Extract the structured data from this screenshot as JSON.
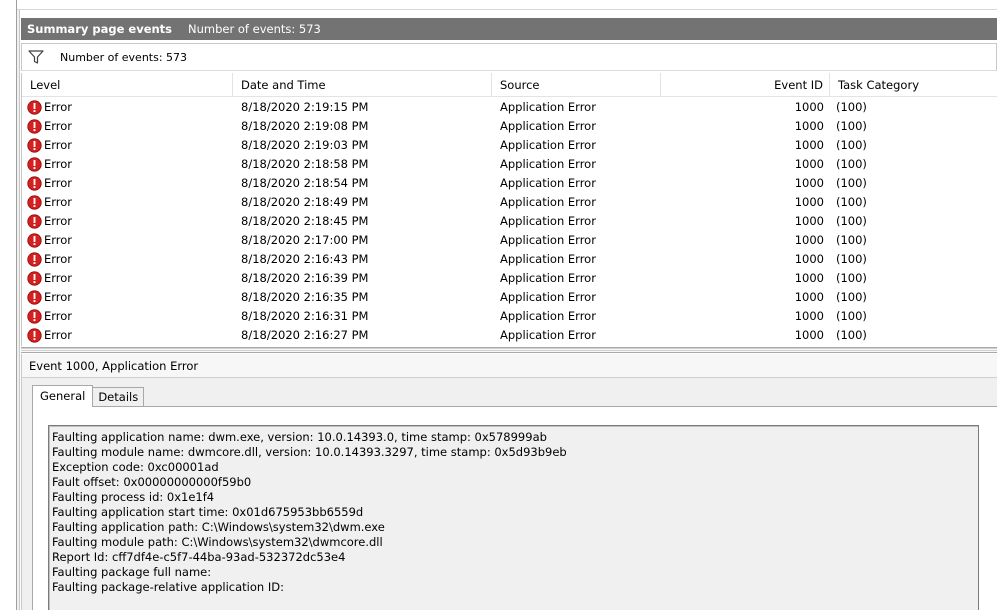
{
  "title_bar": {
    "title": "Summary page events",
    "count_text": "Number of events: 573"
  },
  "filter": {
    "count_text": "Number of events: 573"
  },
  "table": {
    "columns": [
      "Level",
      "Date and Time",
      "Source",
      "Event ID",
      "Task Category"
    ],
    "rows": [
      {
        "level": "Error",
        "date": "8/18/2020 2:19:15 PM",
        "source": "Application Error",
        "event_id": "1000",
        "task": "(100)"
      },
      {
        "level": "Error",
        "date": "8/18/2020 2:19:08 PM",
        "source": "Application Error",
        "event_id": "1000",
        "task": "(100)"
      },
      {
        "level": "Error",
        "date": "8/18/2020 2:19:03 PM",
        "source": "Application Error",
        "event_id": "1000",
        "task": "(100)"
      },
      {
        "level": "Error",
        "date": "8/18/2020 2:18:58 PM",
        "source": "Application Error",
        "event_id": "1000",
        "task": "(100)"
      },
      {
        "level": "Error",
        "date": "8/18/2020 2:18:54 PM",
        "source": "Application Error",
        "event_id": "1000",
        "task": "(100)"
      },
      {
        "level": "Error",
        "date": "8/18/2020 2:18:49 PM",
        "source": "Application Error",
        "event_id": "1000",
        "task": "(100)"
      },
      {
        "level": "Error",
        "date": "8/18/2020 2:18:45 PM",
        "source": "Application Error",
        "event_id": "1000",
        "task": "(100)"
      },
      {
        "level": "Error",
        "date": "8/18/2020 2:17:00 PM",
        "source": "Application Error",
        "event_id": "1000",
        "task": "(100)"
      },
      {
        "level": "Error",
        "date": "8/18/2020 2:16:43 PM",
        "source": "Application Error",
        "event_id": "1000",
        "task": "(100)"
      },
      {
        "level": "Error",
        "date": "8/18/2020 2:16:39 PM",
        "source": "Application Error",
        "event_id": "1000",
        "task": "(100)"
      },
      {
        "level": "Error",
        "date": "8/18/2020 2:16:35 PM",
        "source": "Application Error",
        "event_id": "1000",
        "task": "(100)"
      },
      {
        "level": "Error",
        "date": "8/18/2020 2:16:31 PM",
        "source": "Application Error",
        "event_id": "1000",
        "task": "(100)"
      },
      {
        "level": "Error",
        "date": "8/18/2020 2:16:27 PM",
        "source": "Application Error",
        "event_id": "1000",
        "task": "(100)"
      }
    ]
  },
  "detail": {
    "header": "Event 1000, Application Error",
    "tabs": [
      "General",
      "Details"
    ],
    "message_lines": [
      "Faulting application name: dwm.exe, version: 10.0.14393.0, time stamp: 0x578999ab",
      "Faulting module name: dwmcore.dll, version: 10.0.14393.3297, time stamp: 0x5d93b9eb",
      "Exception code: 0xc00001ad",
      "Fault offset: 0x00000000000f59b0",
      "Faulting process id: 0x1e1f4",
      "Faulting application start time: 0x01d675953bb6559d",
      "Faulting application path: C:\\Windows\\system32\\dwm.exe",
      "Faulting module path: C:\\Windows\\system32\\dwmcore.dll",
      "Report Id: cff7df4e-c5f7-44ba-93ad-532372dc53e4",
      "Faulting package full name: ",
      "Faulting package-relative application ID: "
    ]
  },
  "icons": {
    "error": "error-icon",
    "filter": "filter-icon"
  },
  "colors": {
    "title_bar_bg": "#737373",
    "error_red": "#d32020"
  }
}
